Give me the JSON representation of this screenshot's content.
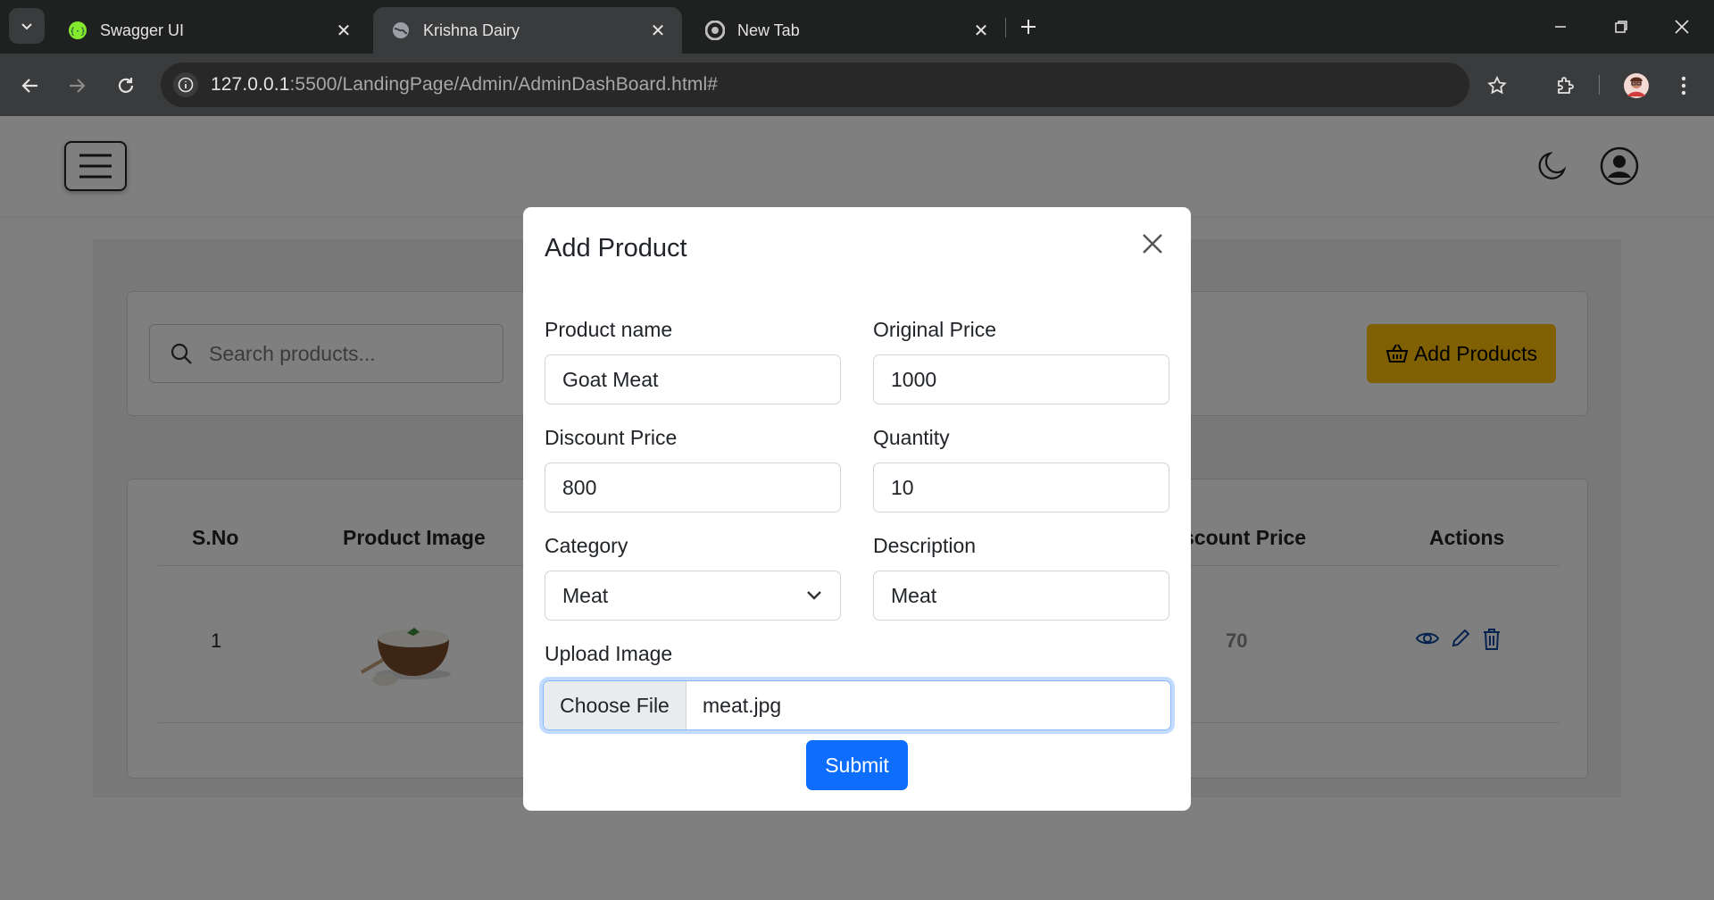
{
  "browser": {
    "tabs": [
      {
        "title": "Swagger UI"
      },
      {
        "title": "Krishna Dairy"
      },
      {
        "title": "New Tab"
      }
    ],
    "url_host": "127.0.0.1",
    "url_rest": ":5500/LandingPage/Admin/AdminDashBoard.html#"
  },
  "page": {
    "search_placeholder": "Search products...",
    "add_products_label": "Add Products",
    "table": {
      "headers": [
        "S.No",
        "Product Image",
        "scount Price",
        "Actions"
      ],
      "rows": [
        {
          "sno": "1",
          "discount_price": "70"
        }
      ]
    }
  },
  "modal": {
    "title": "Add Product",
    "fields": {
      "product_name": {
        "label": "Product name",
        "value": "Goat Meat"
      },
      "original_price": {
        "label": "Original Price",
        "value": "1000"
      },
      "discount_price": {
        "label": "Discount Price",
        "value": "800"
      },
      "quantity": {
        "label": "Quantity",
        "value": "10"
      },
      "category": {
        "label": "Category",
        "value": "Meat"
      },
      "description": {
        "label": "Description",
        "value": "Meat"
      },
      "upload_image": {
        "label": "Upload Image",
        "button": "Choose File",
        "file": "meat.jpg"
      }
    },
    "submit_label": "Submit"
  },
  "colors": {
    "add_products_bg": "#ffc107",
    "submit_bg": "#0d6efd",
    "action_icon": "#0d47a1"
  }
}
